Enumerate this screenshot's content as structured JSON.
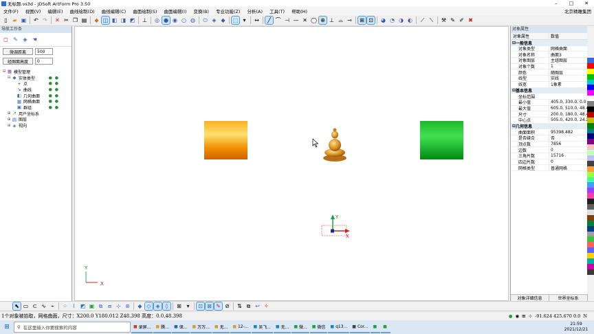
{
  "window": {
    "title": "无标题.vs3d - JDSoft ArtForm Pro 3.50",
    "minimize": "–",
    "maximize": "□",
    "close": "✕"
  },
  "menu": {
    "items": [
      "文件(F)",
      "视图(V)",
      "编辑(E)",
      "曲线绘制(D)",
      "曲线编辑(C)",
      "曲面绘制(S)",
      "曲面编辑(I)",
      "变换(B)",
      "专业功能(Z)",
      "分析(A)",
      "工具(T)",
      "帮助(H)"
    ],
    "user": "北京精雕集团"
  },
  "nav": {
    "title": "导航工作条",
    "mirror_button": "微调距离",
    "mirror_value": "500",
    "height_button": "经图面高度",
    "height_value": "0",
    "tree": [
      {
        "label": "模型管理",
        "indent": 0,
        "exp": "⊟",
        "icon": "▦",
        "color": "#7a4a9a",
        "dots": false
      },
      {
        "label": "实体类型",
        "indent": 1,
        "exp": "⊟",
        "icon": "◆",
        "color": "#3a6ab8",
        "dots": true
      },
      {
        "label": "点",
        "indent": 2,
        "exp": "",
        "icon": "+",
        "color": "#444",
        "dots": true
      },
      {
        "label": "曲线",
        "indent": 2,
        "exp": "",
        "icon": "↘",
        "color": "#444",
        "dots": true
      },
      {
        "label": "几何曲面",
        "indent": 2,
        "exp": "",
        "icon": "◧",
        "color": "#3a6ab8",
        "dots": true
      },
      {
        "label": "网格曲面",
        "indent": 2,
        "exp": "",
        "icon": "▦",
        "color": "#3a6ab8",
        "dots": true
      },
      {
        "label": "群组",
        "indent": 2,
        "exp": "",
        "icon": "▣",
        "color": "#3a6ab8",
        "dots": true
      },
      {
        "label": "用户坐标系",
        "indent": 1,
        "exp": "⊞",
        "icon": "↗",
        "color": "#2a8a3a",
        "dots": false
      },
      {
        "label": "图层",
        "indent": 1,
        "exp": "⊞",
        "icon": "▤",
        "color": "#3a6ab8",
        "dots": false
      },
      {
        "label": "视向",
        "indent": 1,
        "exp": "⊞",
        "icon": "◈",
        "color": "#3a6ab8",
        "dots": false
      }
    ]
  },
  "props": {
    "title": "对象属性",
    "col_name": "对象属性",
    "col_value": "数值",
    "sections": [
      {
        "name": "一般信息",
        "rows": [
          [
            "对象类型",
            "网格曲面"
          ],
          [
            "对象名称",
            "曲面3"
          ],
          [
            "对象图层",
            "主组图层"
          ],
          [
            "对象个数",
            "1"
          ],
          [
            "颜色",
            "随图层"
          ],
          [
            "线型",
            "实线"
          ],
          [
            "线宽",
            "1象素"
          ]
        ]
      },
      {
        "name": "基本信息",
        "rows": [
          [
            "坐标范围",
            ""
          ],
          [
            "最小值",
            "405.0, 330.0, 0.0"
          ],
          [
            "最大值",
            "605.0, 510.0, 48.4"
          ],
          [
            "尺寸",
            "200.0, 180.0, 48.4"
          ],
          [
            "中心点",
            "505.0, 420.0, 24.2"
          ]
        ]
      },
      {
        "name": "几何信息",
        "rows": [
          [
            "曲面面积",
            "95398.482"
          ],
          [
            "是否缝合",
            "否"
          ],
          [
            "顶点数",
            "7856"
          ],
          [
            "边数",
            "0"
          ],
          [
            "三角片数",
            "15716"
          ],
          [
            "四边片数",
            "0"
          ],
          [
            "网格类型",
            "普通网格"
          ]
        ]
      }
    ],
    "footer_left": "对象详细信息",
    "footer_right": "世界坐标系"
  },
  "palette": [
    "#3b6ad6",
    "#ff0000",
    "#ffff00",
    "#00c000",
    "#00c8c8",
    "#0000ff",
    "#ff00ff",
    "#ffffff",
    "#808080",
    "#000000",
    "#c00000",
    "#c0c000",
    "#008000",
    "#008080",
    "#000080",
    "#800080",
    "#ffc0c0",
    "#c0ffc0",
    "#c0c0ff",
    "#404040",
    "#ffa040",
    "#a0ff40",
    "#40ffa0",
    "#40a0ff",
    "#a040ff",
    "#ff40a0",
    "#202020",
    "#606060",
    "#e0e0e0",
    "#804000",
    "#008040",
    "#004080",
    "#a0a0a0",
    "#40c040",
    "#ff6060",
    "#6060ff",
    "#ffd000",
    "#00b0a0",
    "#d000a0",
    "#3a3a3a"
  ],
  "status": {
    "text": "1个对象被拾取，网格曲面，尺寸：X200.0 Y180.012 Z48.398 高度：0.0,48.398",
    "coords": "-91.624 425.670 0.0",
    "mode": "N"
  },
  "viewport": {
    "y_label": "Y",
    "x_label": "X"
  },
  "taskbar": {
    "search": "在这里输入你要搜索的内容",
    "apps": [
      "录屏...",
      "腾…",
      "保...",
      "万万...",
      "无...",
      "12-...",
      "吴飞...",
      "无...",
      "微...",
      "微信",
      "q13...",
      "Cor...",
      "",
      ""
    ],
    "time": "21:59",
    "date": "2021/12/21"
  }
}
